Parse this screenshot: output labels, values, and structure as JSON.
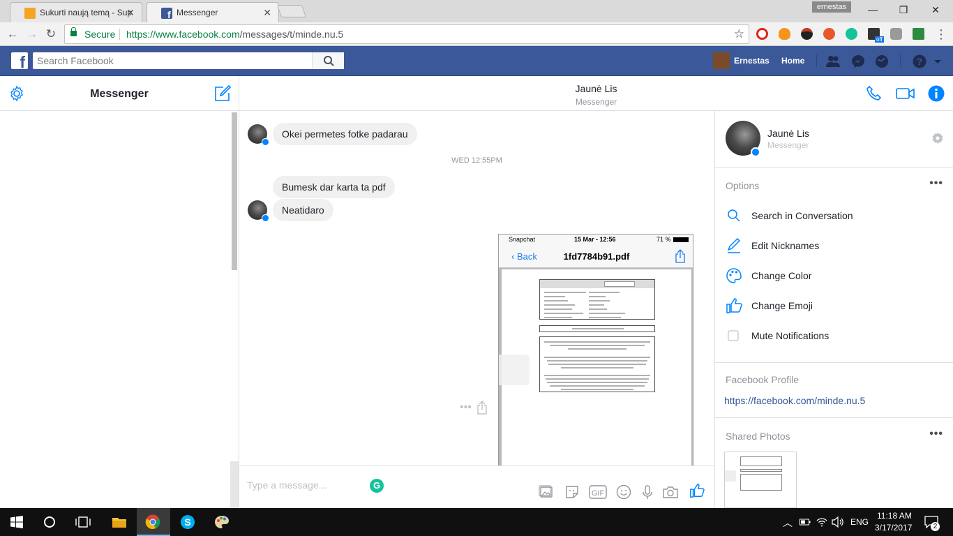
{
  "browser": {
    "tabs": [
      {
        "title": "Sukurti naują temą - Sup",
        "active": false,
        "favicon_color": "#f4a623"
      },
      {
        "title": "Messenger",
        "active": true,
        "favicon_color": "#3b5998"
      }
    ],
    "profile_name": "ernestas",
    "security_label": "Secure",
    "url_origin": "https://www.facebook.com",
    "url_path": "/messages/t/minde.nu.5",
    "extension_badge": "off"
  },
  "facebook": {
    "search_placeholder": "Search Facebook",
    "user_name": "Ernestas",
    "home_label": "Home",
    "brand_color": "#3b5998"
  },
  "messenger": {
    "left_title": "Messenger",
    "conversation": {
      "contact_name": "Jaunė Lis",
      "contact_sub": "Messenger",
      "messages": [
        {
          "text": "Okei permetes fotke padarau"
        },
        {
          "timestamp": "WED 12:55PM"
        },
        {
          "text": "Bumesk dar karta ta pdf"
        },
        {
          "text": "Neatidaro"
        }
      ],
      "photo": {
        "status_app": "Snapchat",
        "status_time": "15 Mar - 12:56",
        "status_battery": "71 %",
        "back_label": "Back",
        "file_title": "1fd7784b91.pdf"
      }
    },
    "composer": {
      "placeholder": "Type a message...",
      "grammarly_label": "G"
    },
    "right_panel": {
      "name": "Jaunė Lis",
      "sub": "Messenger",
      "options_label": "Options",
      "options": [
        {
          "label": "Search in Conversation",
          "icon": "search-icon"
        },
        {
          "label": "Edit Nicknames",
          "icon": "pencil-icon"
        },
        {
          "label": "Change Color",
          "icon": "palette-icon"
        },
        {
          "label": "Change Emoji",
          "icon": "thumbs-up-icon"
        },
        {
          "label": "Mute Notifications",
          "icon": "checkbox-icon"
        }
      ],
      "profile_label": "Facebook Profile",
      "profile_url": "https://facebook.com/minde.nu.5",
      "shared_photos_label": "Shared Photos"
    },
    "accent_color": "#0084ff"
  },
  "taskbar": {
    "language": "ENG",
    "time": "11:18 AM",
    "date": "3/17/2017",
    "notification_count": "2"
  }
}
